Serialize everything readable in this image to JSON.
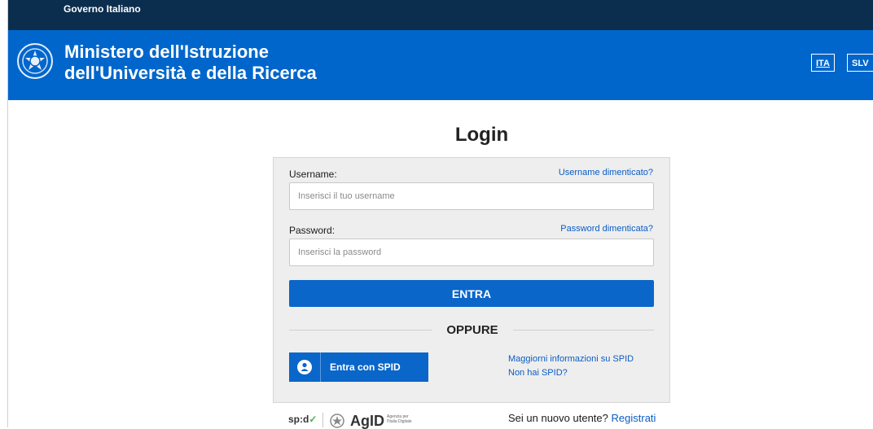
{
  "topbar": {
    "title": "Governo Italiano"
  },
  "header": {
    "ministry_line1": "Ministero dell'Istruzione",
    "ministry_line2": "dell'Università e della Ricerca",
    "languages": [
      "ITA",
      "SLV"
    ]
  },
  "login": {
    "title": "Login",
    "username_label": "Username:",
    "username_forgot": "Username dimenticato?",
    "username_placeholder": "Inserisci il tuo username",
    "password_label": "Password:",
    "password_forgot": "Password dimenticata?",
    "password_placeholder": "Inserisci la password",
    "submit_label": "ENTRA",
    "divider_label": "OPPURE",
    "spid_button_label": "Entra con SPID",
    "spid_info_link": "Maggiorni informazioni su SPID",
    "spid_no_link": "Non hai SPID?"
  },
  "footer": {
    "spid_logo": "sp:d",
    "agid_logo": "AgID",
    "agid_subtitle": "Agenzia per l'Italia Digitale",
    "new_user_text": "Sei un nuovo utente?",
    "register_link": "Registrati"
  },
  "colors": {
    "topbar": "#0b2d4e",
    "header": "#0066cc",
    "primary_button": "#0a66c9",
    "link": "#0b5cc4",
    "panel": "#eeeeee"
  },
  "icons": {
    "emblem": "italian-republic-emblem-icon",
    "spid_user": "user-icon",
    "spid_check": "check-icon"
  }
}
